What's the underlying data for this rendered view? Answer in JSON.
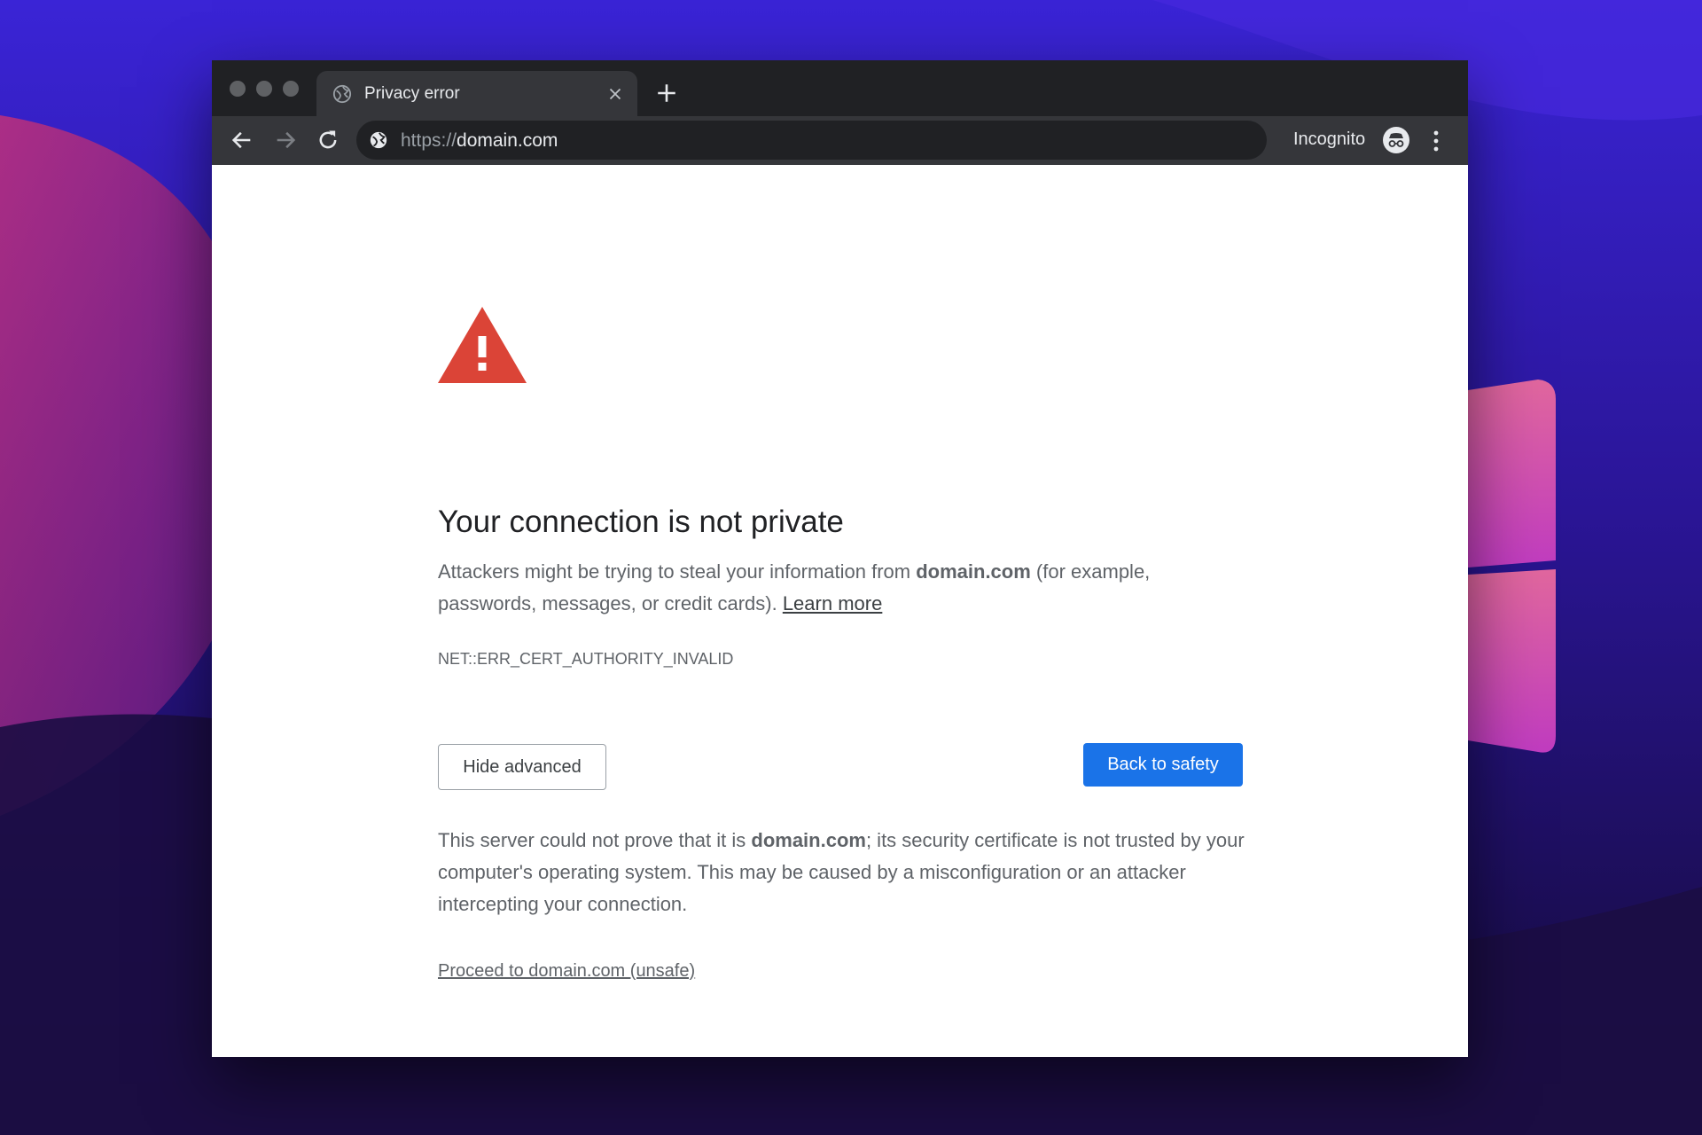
{
  "browser": {
    "tab": {
      "title": "Privacy error",
      "favicon": "globe-icon",
      "close_icon": "close-icon"
    },
    "new_tab_icon": "plus-icon",
    "toolbar": {
      "back_icon": "arrow-left-icon",
      "forward_icon": "arrow-right-icon",
      "reload_icon": "reload-icon",
      "url_scheme": "https://",
      "url_host": "domain.com",
      "site_icon": "globe-icon",
      "incognito_label": "Incognito",
      "incognito_icon": "incognito-icon",
      "menu_icon": "more-vertical-icon"
    }
  },
  "page": {
    "warning_icon": "warning-triangle-icon",
    "heading": "Your connection is not private",
    "intro": {
      "prefix": "Attackers might be trying to steal your information from ",
      "domain": "domain.com",
      "suffix": " (for example, passwords, messages, or credit cards). ",
      "learn_more": "Learn more"
    },
    "error_code": "NET::ERR_CERT_AUTHORITY_INVALID",
    "hide_advanced": "Hide advanced",
    "back_to_safety": "Back to safety",
    "details": {
      "prefix": "This server could not prove that it is ",
      "domain": "domain.com",
      "suffix": "; its security certificate is not trusted by your computer's operating system. This may be caused by a misconfiguration or an attacker intercepting your connection."
    },
    "proceed_link": "Proceed to domain.com (unsafe)"
  },
  "colors": {
    "accent": "#1a73e8",
    "warning": "#db4437",
    "titlebar": "#202124",
    "toolbar": "#35363a"
  }
}
